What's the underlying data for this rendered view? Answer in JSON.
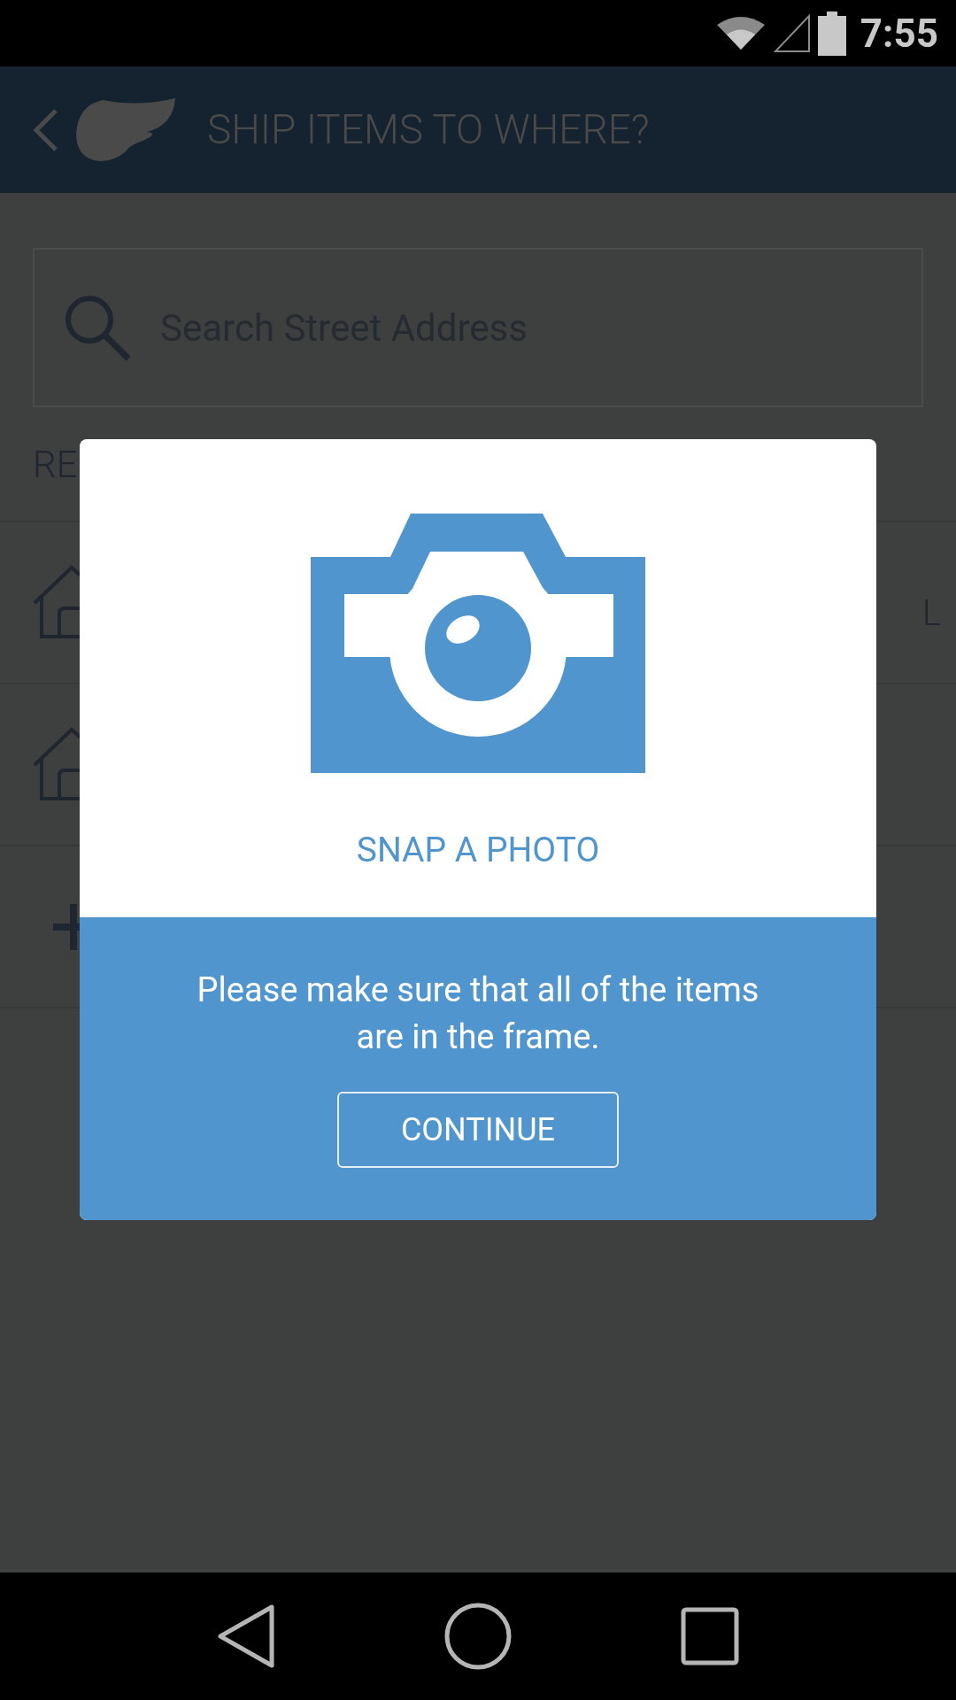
{
  "status_bar": {
    "time": "7:55"
  },
  "header": {
    "title": "SHIP ITEMS TO WHERE?"
  },
  "search": {
    "placeholder": "Search Street Address"
  },
  "section": {
    "label": "RE"
  },
  "rows": [
    {
      "kind": "address",
      "trailing": "L"
    },
    {
      "kind": "address"
    },
    {
      "kind": "add"
    }
  ],
  "dialog": {
    "title": "SNAP A PHOTO",
    "message": "Please make sure that all of the items are in the frame.",
    "button": "CONTINUE"
  }
}
